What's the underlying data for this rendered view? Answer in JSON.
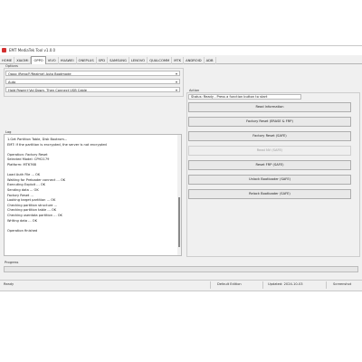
{
  "window": {
    "title": "EMT MediaTek Tool v1.0.0"
  },
  "tabs": [
    "HOME",
    "XIAOMI",
    "OPPO",
    "VIVO",
    "HUAWEI",
    "ONEPLUS",
    "SPD",
    "SAMSUNG",
    "LENOVO",
    "QUALCOMM",
    "MTK",
    "ANDROID",
    "ADB"
  ],
  "active_tab_index": 2,
  "options": {
    "label": "Options",
    "model_select": "Oppo (Reno/F/Realme) Auto Bootmode",
    "mode_select": "Auto",
    "hint_select": "Hold Power+Vol Down, Then Connect USB Cable"
  },
  "log": {
    "label": "Log",
    "lines": [
      "1.Get Partition Table, Disk Bootrom...",
      "EMT: If the partition is encrypted, the server is not encrypted",
      "",
      "Operation: Factory Reset",
      "Selected Model: CPH2179",
      "Platform: MT6768",
      "",
      "Load Auth File ... OK",
      "Waiting for Preloader connect ... OK",
      "Executing Exploit ... OK",
      "Sending data ... OK",
      "Factory Reset ...",
      "Looking target partition ... OK",
      "Checking partition structure ...",
      "Checking partition table ... OK",
      "Checking userdata partition ... OK",
      "Writing data ... OK",
      "",
      "Operation finished"
    ]
  },
  "action": {
    "label": "Action",
    "imei_value": "Status: Ready - Press a function button to start",
    "buttons": [
      {
        "label": "Read Information",
        "enabled": true
      },
      {
        "label": "Factory Reset (ERASE & FRP)",
        "enabled": true
      },
      {
        "label": "Factory Reset (SAFE)",
        "enabled": true
      },
      {
        "label": "Read NV (SAFE)",
        "enabled": false
      },
      {
        "label": "Reset FRP (SAFE)",
        "enabled": true
      },
      {
        "label": "Unlock Bootloader (SAFE)",
        "enabled": true
      },
      {
        "label": "Relock Bootloader (SAFE)",
        "enabled": true
      }
    ]
  },
  "progress": {
    "label": "Progress",
    "value": 0
  },
  "status": {
    "left": "Ready",
    "middle": "Default Edition",
    "date": "Updated: 2024-10-03",
    "right": "Screenshot"
  },
  "colors": {
    "accent_red": "#d32f2f",
    "progress": "#06b025",
    "window_bg": "#f0f0f0"
  }
}
